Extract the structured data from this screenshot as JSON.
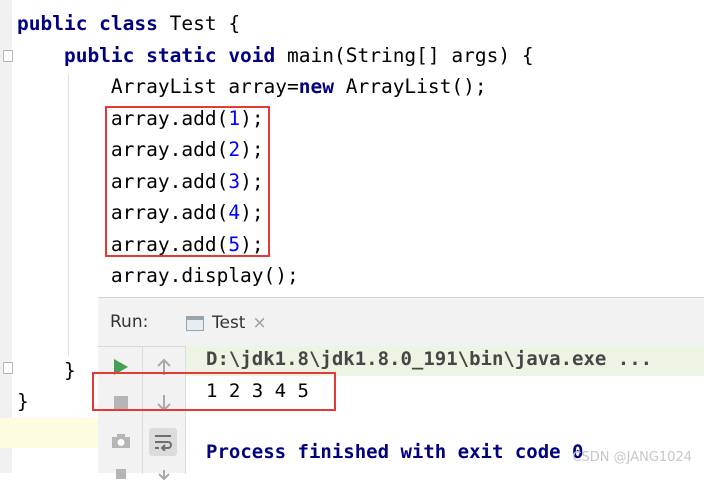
{
  "editor": {
    "lines": [
      {
        "segments": [
          {
            "t": "public class ",
            "k": "kw"
          },
          {
            "t": "Test {",
            "k": ""
          }
        ]
      },
      {
        "segments": [
          {
            "t": "    public static void ",
            "k": "kw"
          },
          {
            "t": "main(String[] args) {",
            "k": ""
          }
        ]
      },
      {
        "segments": [
          {
            "t": "        ArrayList array=",
            "k": ""
          },
          {
            "t": "new ",
            "k": "kw"
          },
          {
            "t": "ArrayList();",
            "k": ""
          }
        ]
      },
      {
        "segments": [
          {
            "t": "        array.add(",
            "k": ""
          },
          {
            "t": "1",
            "k": "num"
          },
          {
            "t": ");",
            "k": ""
          }
        ]
      },
      {
        "segments": [
          {
            "t": "        array.add(",
            "k": ""
          },
          {
            "t": "2",
            "k": "num"
          },
          {
            "t": ");",
            "k": ""
          }
        ]
      },
      {
        "segments": [
          {
            "t": "        array.add(",
            "k": ""
          },
          {
            "t": "3",
            "k": "num"
          },
          {
            "t": ");",
            "k": ""
          }
        ]
      },
      {
        "segments": [
          {
            "t": "        array.add(",
            "k": ""
          },
          {
            "t": "4",
            "k": "num"
          },
          {
            "t": ");",
            "k": ""
          }
        ]
      },
      {
        "segments": [
          {
            "t": "        array.add(",
            "k": ""
          },
          {
            "t": "5",
            "k": "num"
          },
          {
            "t": ");",
            "k": ""
          }
        ]
      },
      {
        "segments": [
          {
            "t": "        array.display();",
            "k": ""
          }
        ]
      }
    ],
    "closing_inner": "    }",
    "closing_outer": "}"
  },
  "run": {
    "label": "Run:",
    "tab_label": "Test",
    "close_glyph": "×",
    "command": "D:\\jdk1.8\\jdk1.8.0_191\\bin\\java.exe ...",
    "output": "1 2 3 4 5",
    "exit_message": "Process finished with exit code 0"
  },
  "watermark": "CSDN @JANG1024",
  "colors": {
    "keyword": "#000080",
    "number": "#0000ff",
    "highlight_box": "#e53935",
    "run_green": "#499c54"
  }
}
